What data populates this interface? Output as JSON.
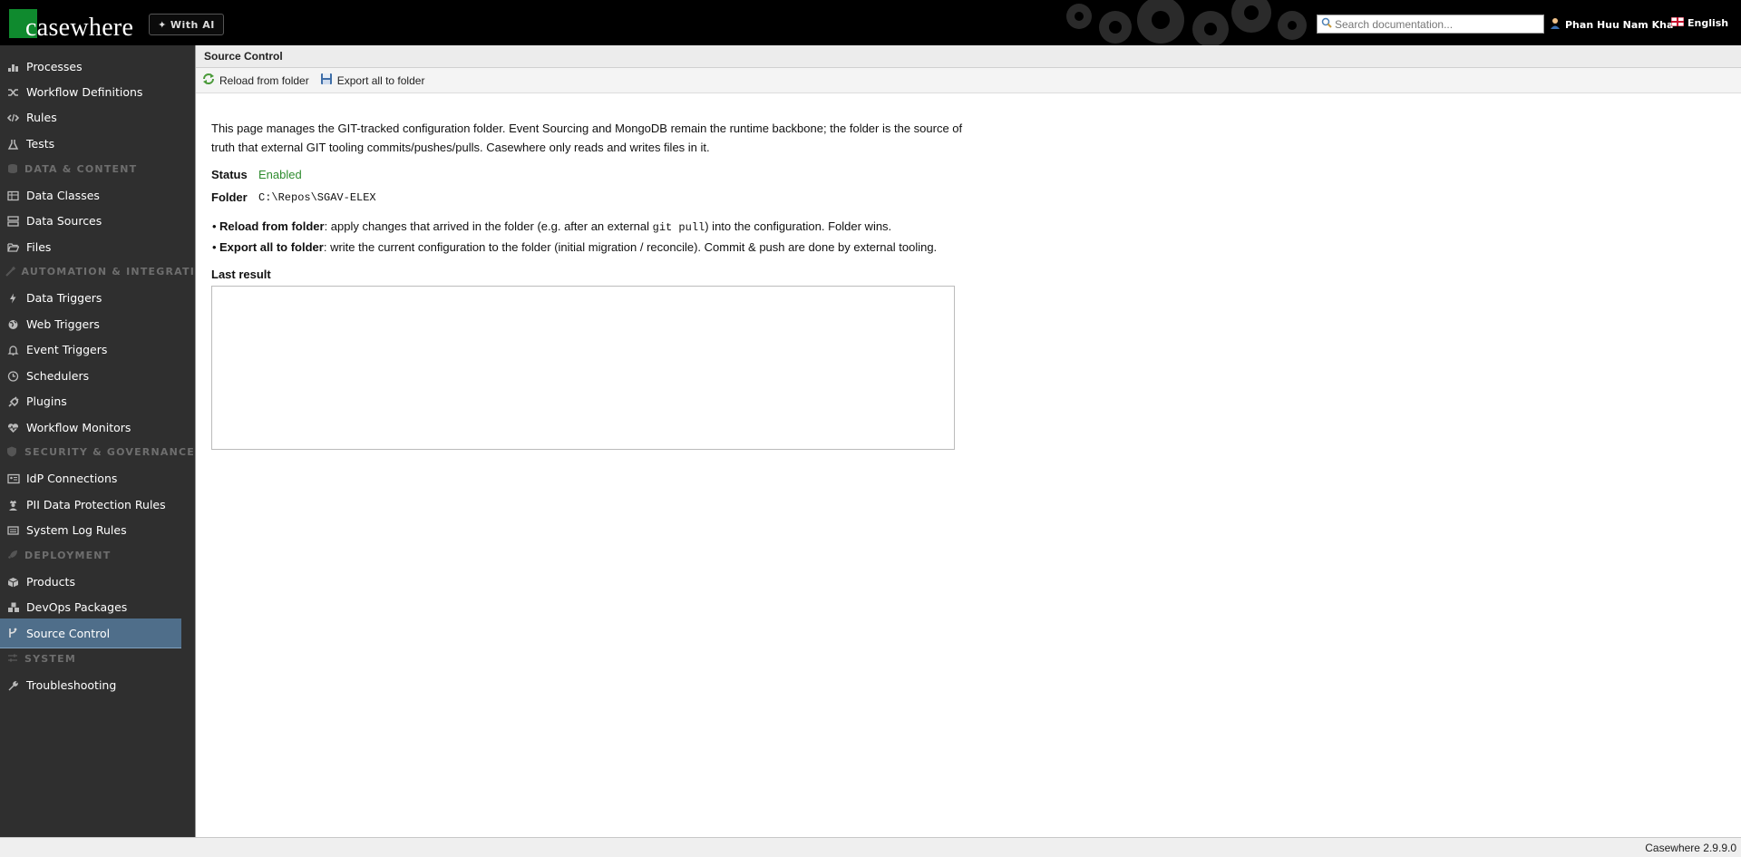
{
  "header": {
    "logo_text": "casewhere",
    "with_ai_label": "With AI",
    "search_placeholder": "Search documentation...",
    "user_name": "Phan Huu Nam Kha",
    "language": "English",
    "brand_color": "#0f8a2e"
  },
  "sidebar": {
    "items": [
      {
        "label": "Processes",
        "icon": "processes-icon"
      },
      {
        "label": "Workflow Definitions",
        "icon": "shuffle-icon"
      },
      {
        "label": "Rules",
        "icon": "code-icon"
      },
      {
        "label": "Tests",
        "icon": "flask-icon"
      },
      {
        "section": "DATA & CONTENT",
        "icon": "database-icon"
      },
      {
        "label": "Data Classes",
        "icon": "table-icon"
      },
      {
        "label": "Data Sources",
        "icon": "server-icon"
      },
      {
        "label": "Files",
        "icon": "folder-open-icon"
      },
      {
        "section": "AUTOMATION & INTEGRATI",
        "icon": "wand-icon"
      },
      {
        "label": "Data Triggers",
        "icon": "bolt-icon"
      },
      {
        "label": "Web Triggers",
        "icon": "globe-icon"
      },
      {
        "label": "Event Triggers",
        "icon": "bell-icon"
      },
      {
        "label": "Schedulers",
        "icon": "clock-icon"
      },
      {
        "label": "Plugins",
        "icon": "plug-icon"
      },
      {
        "label": "Workflow Monitors",
        "icon": "heartbeat-icon"
      },
      {
        "section": "SECURITY & GOVERNANCE",
        "icon": "shield-icon"
      },
      {
        "label": "IdP Connections",
        "icon": "id-card-icon"
      },
      {
        "label": "PII Data Protection Rules",
        "icon": "user-secret-icon"
      },
      {
        "label": "System Log Rules",
        "icon": "list-icon"
      },
      {
        "section": "DEPLOYMENT",
        "icon": "rocket-icon"
      },
      {
        "label": "Products",
        "icon": "box-icon"
      },
      {
        "label": "DevOps Packages",
        "icon": "cubes-icon"
      },
      {
        "label": "Source Control",
        "icon": "code-branch-icon",
        "active": true
      },
      {
        "section": "SYSTEM",
        "icon": "sliders-icon"
      },
      {
        "label": "Troubleshooting",
        "icon": "wrench-icon"
      }
    ]
  },
  "page": {
    "title": "Source Control",
    "toolbar": {
      "reload_label": "Reload from folder",
      "export_label": "Export all to folder"
    },
    "description": "This page manages the GIT-tracked configuration folder. Event Sourcing and MongoDB remain the runtime backbone; the folder is the source of truth that external GIT tooling commits/pushes/pulls. Casewhere only reads and writes files in it.",
    "status_label": "Status",
    "status_value": "Enabled",
    "status_color": "#2e8b2e",
    "folder_label": "Folder",
    "folder_value": "C:\\Repos\\SGAV-ELEX",
    "bullets": {
      "reload_title": "Reload from folder",
      "reload_text_a": ": apply changes that arrived in the folder (e.g. after an external ",
      "reload_code": "git pull",
      "reload_text_b": ") into the configuration. Folder wins.",
      "export_title": "Export all to folder",
      "export_text": ": write the current configuration to the folder (initial migration / reconcile). Commit & push are done by external tooling."
    },
    "last_result_label": "Last result",
    "last_result_value": ""
  },
  "footer": {
    "version": "Casewhere 2.9.9.0"
  }
}
